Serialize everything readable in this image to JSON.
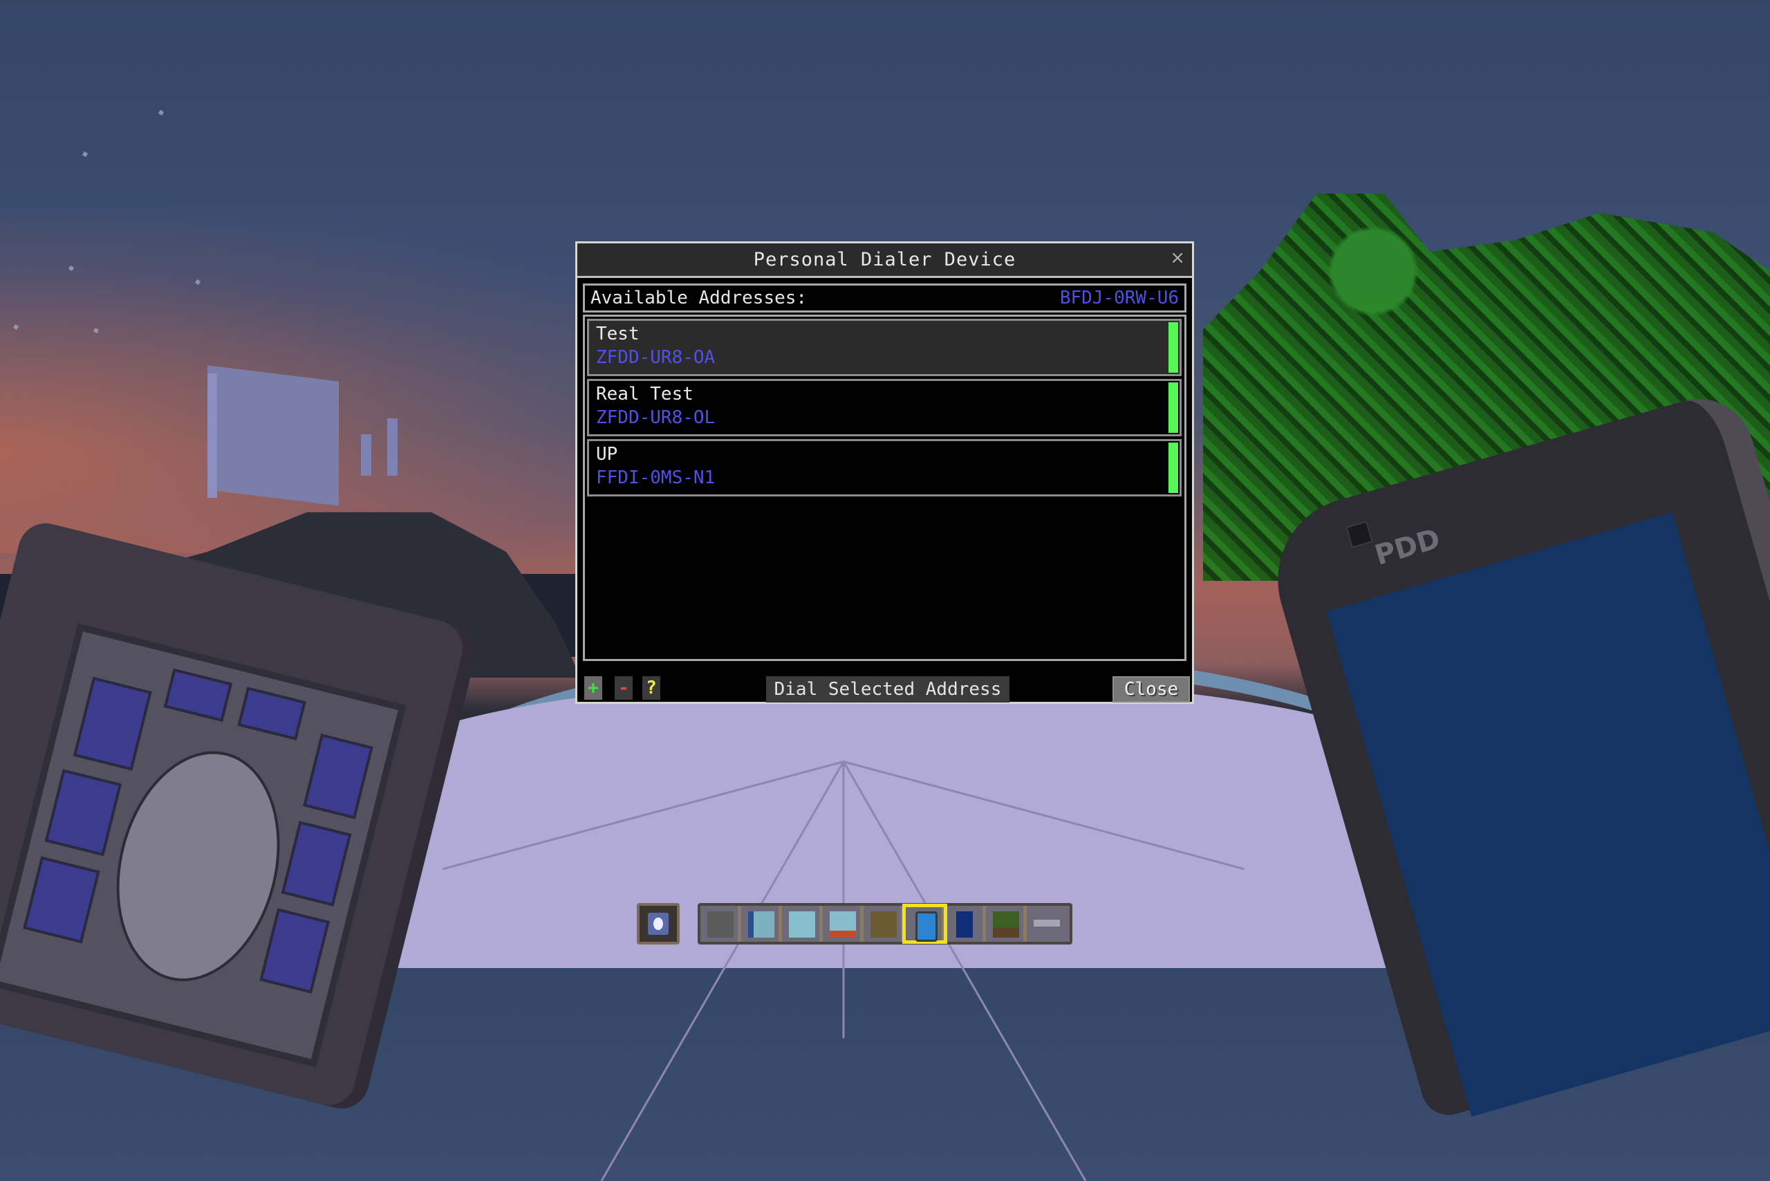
{
  "dialog": {
    "title": "Personal Dialer Device",
    "close_icon": "×",
    "available_label": "Available Addresses:",
    "own_address": "BFDJ-0RW-U6",
    "entries": [
      {
        "name": "Test",
        "address": "ZFDD-UR8-OA",
        "selected": true,
        "status": "available"
      },
      {
        "name": "Real Test",
        "address": "ZFDD-UR8-OL",
        "selected": false,
        "status": "available"
      },
      {
        "name": "UP",
        "address": "FFDI-0MS-N1",
        "selected": false,
        "status": "available"
      }
    ],
    "buttons": {
      "add": "+",
      "remove": "-",
      "help": "?",
      "dial": "Dial Selected Address",
      "close": "Close"
    }
  },
  "colors": {
    "address_blue": "#4f4fe6",
    "status_green": "#55f755",
    "hotbar_selected": "#f2e21c"
  },
  "scene": {
    "held_item_right_label": "PDD"
  },
  "hotbar": {
    "offhand": "stargate-dhd-item",
    "selected_index": 5,
    "slots": [
      "stone-slab",
      "stargate-ring-block",
      "naquadah-block",
      "chevron-block",
      "wooden-stairs",
      "personal-dialer-device",
      "tablet",
      "grass-block",
      "key-item"
    ]
  }
}
